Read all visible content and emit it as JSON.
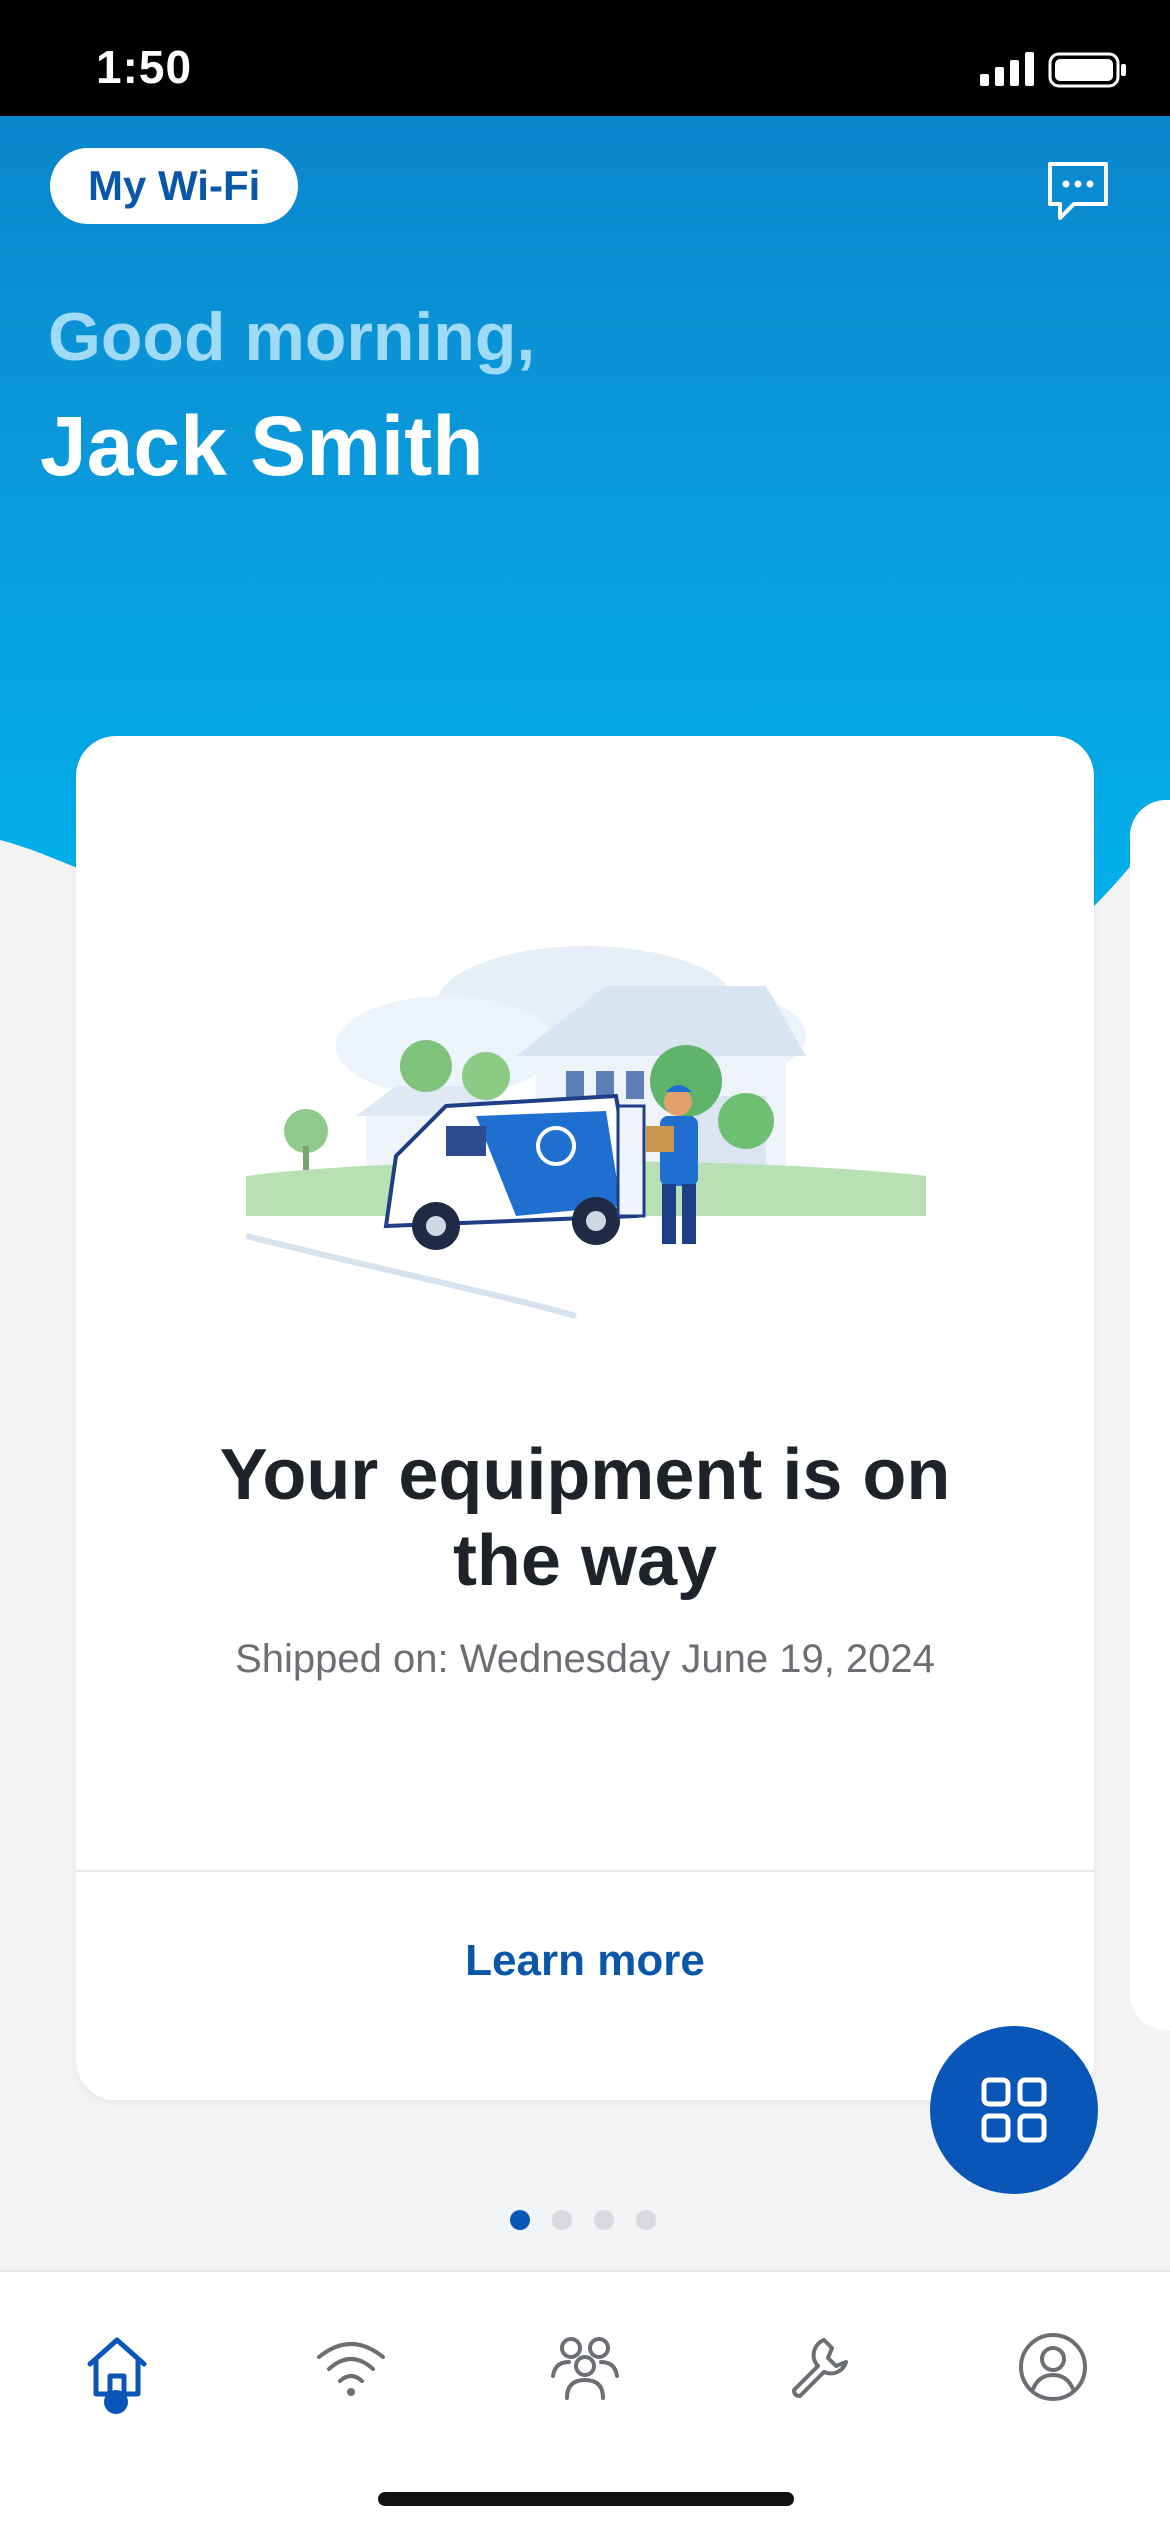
{
  "status_bar": {
    "time": "1:50"
  },
  "header": {
    "wifi_pill_label": "My Wi-Fi",
    "greeting": "Good morning,",
    "user_name": "Jack Smith"
  },
  "card": {
    "title": "Your equipment is on the way",
    "subtitle": "Shipped on: Wednesday June 19, 2024",
    "action_label": "Learn more"
  },
  "carousel": {
    "total_pages": 4,
    "active_page": 1
  },
  "tab_bar": {
    "tabs": [
      {
        "icon": "home-icon",
        "active": true
      },
      {
        "icon": "wifi-icon",
        "active": false
      },
      {
        "icon": "people-icon",
        "active": false
      },
      {
        "icon": "wrench-icon",
        "active": false
      },
      {
        "icon": "profile-icon",
        "active": false
      }
    ]
  },
  "colors": {
    "brand_blue": "#0a56b8",
    "hero_top": "#0a86cd",
    "hero_bottom": "#00b3ec",
    "background": "#f2f3f5"
  }
}
